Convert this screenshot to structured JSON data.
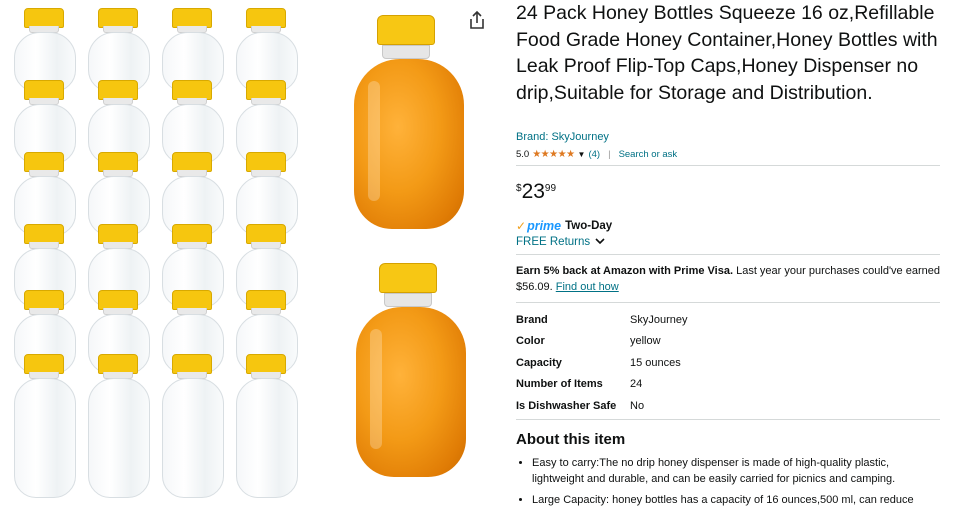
{
  "gallery": {
    "bottle_count": 24,
    "cap_color": "#F6C60F",
    "main_cap_color": "#F7C714",
    "honey_color": "#F39A16"
  },
  "product": {
    "title": "24 Pack Honey Bottles Squeeze 16 oz,Refillable Food Grade Honey Container,Honey Bottles with Leak Proof Flip-Top Caps,Honey Dispenser no drip,Suitable for Storage and Distribution.",
    "brand_link": "Brand: SkyJourney",
    "rating_value": "5.0",
    "stars": "★★★★★",
    "rating_count": "(4)",
    "search_link": "Search or ask",
    "price": {
      "symbol": "$",
      "whole": "23",
      "fraction": "99"
    },
    "prime_check": "✓",
    "prime_logo": "prime",
    "prime_shipping": "Two-Day",
    "returns": "FREE Returns",
    "earn_bold": "Earn 5% back at Amazon with Prime Visa.",
    "earn_text": " Last year your purchases could've earned $56.09. ",
    "earn_link": "Find out how",
    "specs": [
      {
        "key": "Brand",
        "value": "SkyJourney"
      },
      {
        "key": "Color",
        "value": "yellow"
      },
      {
        "key": "Capacity",
        "value": "15 ounces"
      },
      {
        "key": "Number of Items",
        "value": "24"
      },
      {
        "key": "Is Dishwasher Safe",
        "value": "No"
      }
    ],
    "about_heading": "About this item",
    "bullets": [
      "Easy to carry:The no drip honey dispenser is made of high-quality plastic, lightweight and durable, and can be easily carried for picnics and camping.",
      "Large Capacity: honey bottles has a capacity of 16 ounces,500 ml, can reduce"
    ]
  },
  "colors": {
    "link": "#007185",
    "star": "#DE7921",
    "prime": "#1A98FF"
  }
}
